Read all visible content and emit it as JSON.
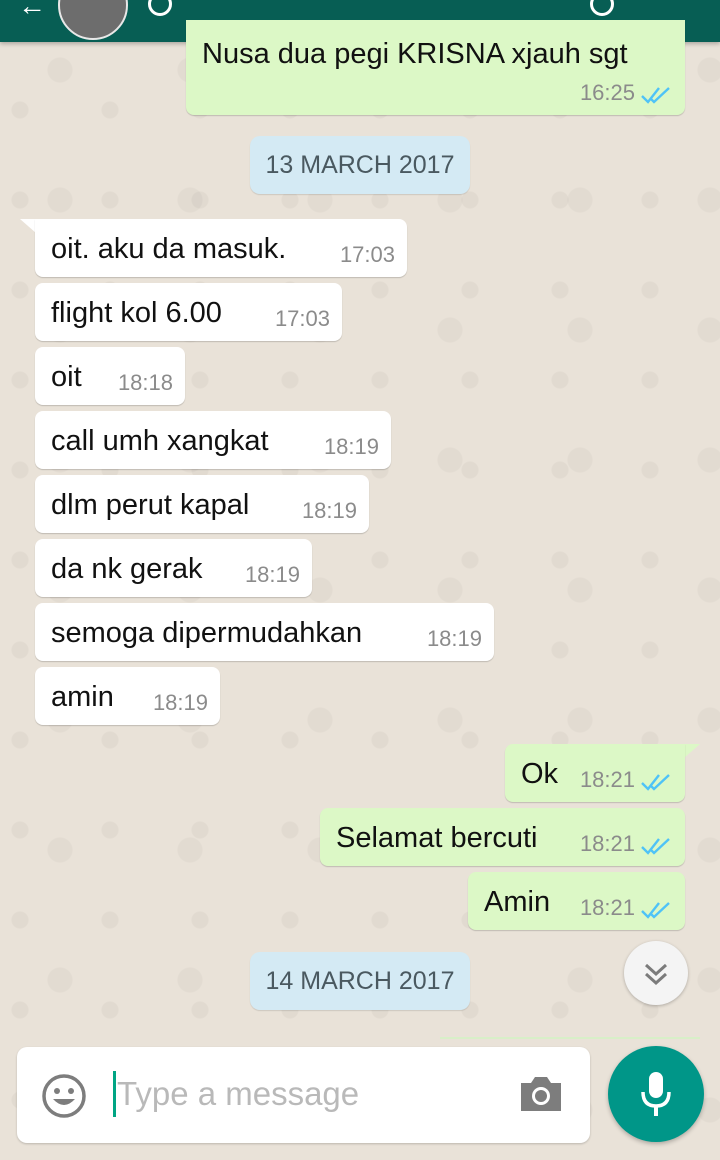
{
  "chat": {
    "input_placeholder": "Type a message",
    "top_partial_message": {
      "text": "Nusa dua pegi KRISNA xjauh sgt",
      "time": "16:25"
    },
    "date_separators": [
      "13 MARCH 2017",
      "14 MARCH 2017"
    ],
    "incoming": [
      {
        "text": "oit. aku da masuk.",
        "time": "17:03"
      },
      {
        "text": "flight kol 6.00",
        "time": "17:03"
      },
      {
        "text": "oit",
        "time": "18:18"
      },
      {
        "text": "call umh xangkat",
        "time": "18:19"
      },
      {
        "text": "dlm perut kapal",
        "time": "18:19"
      },
      {
        "text": "da nk gerak",
        "time": "18:19"
      },
      {
        "text": "semoga dipermudahkan",
        "time": "18:19"
      },
      {
        "text": "amin",
        "time": "18:19"
      }
    ],
    "outgoing": [
      {
        "text": "Ok",
        "time": "18:21"
      },
      {
        "text": "Selamat bercuti",
        "time": "18:21"
      },
      {
        "text": "Amin",
        "time": "18:21"
      }
    ]
  },
  "colors": {
    "header": "#075e54",
    "outgoing_bubble": "#dcf8c6",
    "incoming_bubble": "#ffffff",
    "date_chip": "#d4eaf4",
    "read_ticks": "#4fc3f7",
    "mic_button": "#009688"
  },
  "icons": [
    "back-arrow-icon",
    "contact-avatar",
    "emoji-icon",
    "camera-icon",
    "mic-icon",
    "scroll-down-icon",
    "double-tick-icon"
  ]
}
